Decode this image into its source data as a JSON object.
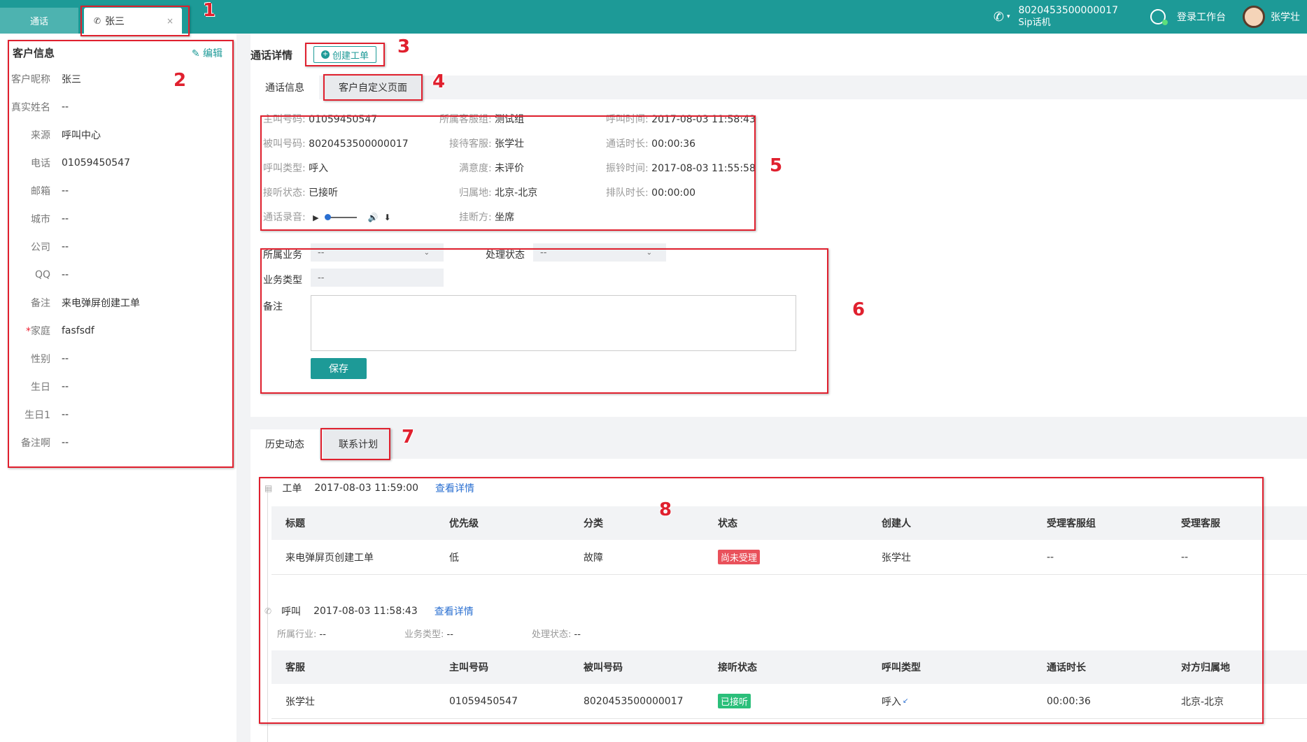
{
  "topbar": {
    "tab_call": "通话",
    "tab_person": "张三",
    "sip_number": "8020453500000017",
    "sip_device": "Sip话机",
    "workspace_label": "登录工作台",
    "username": "张学壮"
  },
  "customer": {
    "title": "客户信息",
    "edit_label": "编辑",
    "fields": [
      {
        "key": "客户昵称",
        "value": "张三"
      },
      {
        "key": "真实姓名",
        "value": "--"
      },
      {
        "key": "来源",
        "value": "呼叫中心"
      },
      {
        "key": "电话",
        "value": "01059450547"
      },
      {
        "key": "邮箱",
        "value": "--"
      },
      {
        "key": "城市",
        "value": "--"
      },
      {
        "key": "公司",
        "value": "--"
      },
      {
        "key": "QQ",
        "value": "--"
      },
      {
        "key": "备注",
        "value": "来电弹屏创建工单"
      },
      {
        "key": "家庭",
        "value": "fasfsdf",
        "required": "*"
      },
      {
        "key": "性别",
        "value": "--"
      },
      {
        "key": "生日",
        "value": "--"
      },
      {
        "key": "生日1",
        "value": "--"
      },
      {
        "key": "备注啊",
        "value": "--"
      }
    ]
  },
  "detail": {
    "title": "通话详情",
    "create_ticket": "创建工单",
    "tabs": [
      "通话信息",
      "客户自定义页面"
    ],
    "info": {
      "caller_k": "主叫号码:",
      "caller_v": "01059450547",
      "group_k": "所属客服组:",
      "group_v": "测试组",
      "calltime_k": "呼叫时间:",
      "calltime_v": "2017-08-03 11:58:43",
      "callee_k": "被叫号码:",
      "callee_v": "8020453500000017",
      "agent_k": "接待客服:",
      "agent_v": "张学壮",
      "duration_k": "通话时长:",
      "duration_v": "00:00:36",
      "calltype_k": "呼叫类型:",
      "calltype_v": "呼入",
      "satisfaction_k": "满意度:",
      "satisfaction_v": "未评价",
      "ringtime_k": "振铃时间:",
      "ringtime_v": "2017-08-03 11:55:58",
      "answer_k": "接听状态:",
      "answer_v": "已接听",
      "location_k": "归属地:",
      "location_v": "北京-北京",
      "queue_k": "排队时长:",
      "queue_v": "00:00:00",
      "recording_k": "通话录音:",
      "hangup_k": "挂断方:",
      "hangup_v": "坐席"
    },
    "form": {
      "business_label": "所属业务",
      "business_value": "--",
      "status_label": "处理状态",
      "status_value": "--",
      "btype_label": "业务类型",
      "btype_value": "--",
      "note_label": "备注",
      "save": "保存"
    }
  },
  "history": {
    "tabs": [
      "历史动态",
      "联系计划"
    ],
    "ticket": {
      "type": "工单",
      "time": "2017-08-03 11:59:00",
      "link": "查看详情",
      "columns": [
        "标题",
        "优先级",
        "分类",
        "状态",
        "创建人",
        "受理客服组",
        "受理客服"
      ],
      "row": [
        "来电弹屏页创建工单",
        "低",
        "故障",
        "尚未受理",
        "张学壮",
        "--",
        "--"
      ]
    },
    "call": {
      "type": "呼叫",
      "time": "2017-08-03 11:58:43",
      "link": "查看详情",
      "meta": {
        "industry_k": "所属行业:",
        "industry_v": "--",
        "btype_k": "业务类型:",
        "btype_v": "--",
        "status_k": "处理状态:",
        "status_v": "--"
      },
      "columns": [
        "客服",
        "主叫号码",
        "被叫号码",
        "接听状态",
        "呼叫类型",
        "通话时长",
        "对方归属地"
      ],
      "row": [
        "张学壮",
        "01059450547",
        "8020453500000017",
        "已接听",
        "呼入",
        "00:00:36",
        "北京-北京"
      ]
    }
  },
  "annotations": [
    "1",
    "2",
    "3",
    "4",
    "5",
    "6",
    "7",
    "8"
  ]
}
